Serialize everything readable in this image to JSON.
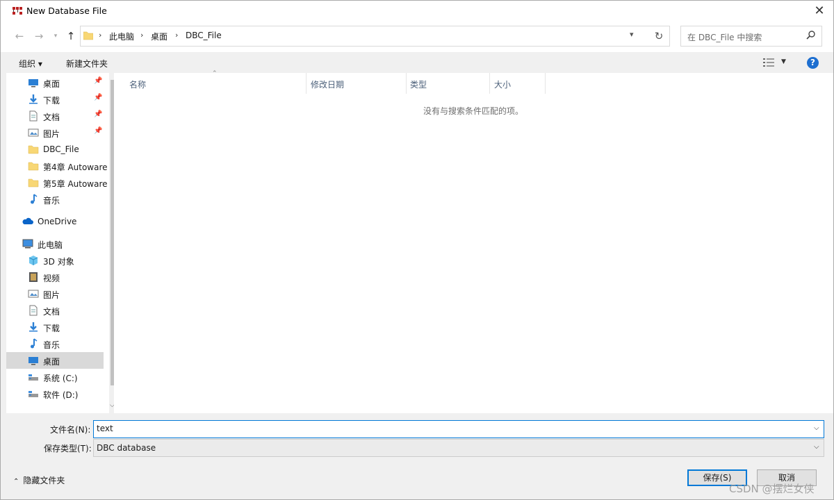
{
  "window": {
    "title": "New Database File",
    "close_glyph": "✕"
  },
  "nav": {
    "breadcrumbs": [
      "此电脑",
      "桌面",
      "DBC_File"
    ],
    "search_placeholder": "在 DBC_File 中搜索"
  },
  "toolbar": {
    "organize_label": "组织 ▾",
    "new_folder_label": "新建文件夹",
    "help_label": "?"
  },
  "sidebar": {
    "items": [
      {
        "label": "桌面",
        "icon": "desktop-icon",
        "pinned": true
      },
      {
        "label": "下载",
        "icon": "download-icon",
        "pinned": true
      },
      {
        "label": "文档",
        "icon": "document-icon",
        "pinned": true
      },
      {
        "label": "图片",
        "icon": "picture-icon",
        "pinned": true
      },
      {
        "label": "DBC_File",
        "icon": "folder-icon"
      },
      {
        "label": "第4章 Autoware",
        "icon": "folder-icon"
      },
      {
        "label": "第5章 Autoware",
        "icon": "folder-icon"
      },
      {
        "label": "音乐",
        "icon": "music-icon"
      },
      {
        "label": "OneDrive",
        "icon": "cloud-icon"
      },
      {
        "label": "此电脑",
        "icon": "computer-icon"
      },
      {
        "label": "3D 对象",
        "icon": "cube-icon"
      },
      {
        "label": "视频",
        "icon": "video-icon"
      },
      {
        "label": "图片",
        "icon": "picture-icon"
      },
      {
        "label": "文档",
        "icon": "document-icon"
      },
      {
        "label": "下载",
        "icon": "download-icon"
      },
      {
        "label": "音乐",
        "icon": "music-icon"
      },
      {
        "label": "桌面",
        "icon": "desktop-icon",
        "selected": true
      },
      {
        "label": "系统 (C:)",
        "icon": "drive-icon"
      },
      {
        "label": "软件 (D:)",
        "icon": "drive-icon"
      }
    ]
  },
  "content": {
    "columns": [
      "名称",
      "修改日期",
      "类型",
      "大小"
    ],
    "empty_message": "没有与搜索条件匹配的项。"
  },
  "form": {
    "filename_label": "文件名(N):",
    "filename_value": "text",
    "filetype_label": "保存类型(T):",
    "filetype_value": "DBC database"
  },
  "footer": {
    "hide_folders_label": "隐藏文件夹",
    "save_label": "保存(S)",
    "cancel_label": "取消"
  },
  "watermark": "CSDN @摆烂女侠",
  "colors": {
    "accent": "#0078d7",
    "folder": "#f8d775",
    "help": "#1e6fd0"
  }
}
